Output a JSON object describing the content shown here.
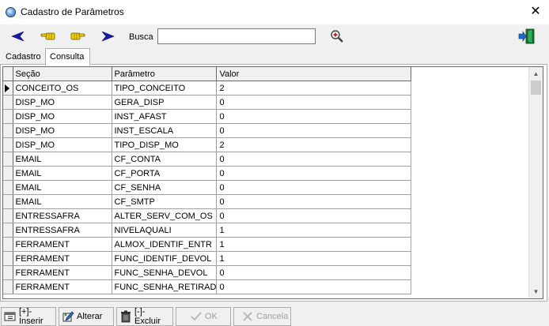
{
  "window": {
    "title": "Cadastro de Parâmetros",
    "close_glyph": "✕"
  },
  "toolbar": {
    "nav": [
      {
        "name": "first-record",
        "icon": "arrow-first-icon",
        "color": "#1a1aa8"
      },
      {
        "name": "prev-record",
        "icon": "hand-left-icon",
        "color": "#c8a000"
      },
      {
        "name": "next-record",
        "icon": "hand-right-icon",
        "color": "#c8a000"
      },
      {
        "name": "last-record",
        "icon": "arrow-last-icon",
        "color": "#1a1aa8"
      }
    ],
    "search_label": "Busca",
    "search_value": "",
    "search_icon": "zoom-icon",
    "exit_icon": "exit-door-icon"
  },
  "tabs": [
    {
      "label": "Cadastro",
      "active": false
    },
    {
      "label": "Consulta",
      "active": true
    }
  ],
  "grid": {
    "columns": [
      "Seção",
      "Parâmetro",
      "Valor"
    ],
    "rows": [
      [
        "CONCEITO_OS",
        "TIPO_CONCEITO",
        "2"
      ],
      [
        "DISP_MO",
        "GERA_DISP",
        "0"
      ],
      [
        "DISP_MO",
        "INST_AFAST",
        "0"
      ],
      [
        "DISP_MO",
        "INST_ESCALA",
        "0"
      ],
      [
        "DISP_MO",
        "TIPO_DISP_MO",
        "2"
      ],
      [
        "EMAIL",
        "CF_CONTA",
        "0"
      ],
      [
        "EMAIL",
        "CF_PORTA",
        "0"
      ],
      [
        "EMAIL",
        "CF_SENHA",
        "0"
      ],
      [
        "EMAIL",
        "CF_SMTP",
        "0"
      ],
      [
        "ENTRESSAFRA",
        "ALTER_SERV_COM_OS",
        "0"
      ],
      [
        "ENTRESSAFRA",
        "NIVELAQUALI",
        "1"
      ],
      [
        "FERRAMENT",
        "ALMOX_IDENTIF_ENTR",
        "1"
      ],
      [
        "FERRAMENT",
        "FUNC_IDENTIF_DEVOL",
        "1"
      ],
      [
        "FERRAMENT",
        "FUNC_SENHA_DEVOL",
        "0"
      ],
      [
        "FERRAMENT",
        "FUNC_SENHA_RETIRAD",
        "0"
      ]
    ],
    "selected_row": 0
  },
  "buttons": [
    {
      "name": "inserir-button",
      "label": "[+]-Inserir",
      "icon": "insert-icon",
      "enabled": true
    },
    {
      "name": "alterar-button",
      "label": "Alterar",
      "icon": "edit-icon",
      "enabled": true
    },
    {
      "name": "excluir-button",
      "label": "[-]-Excluir",
      "icon": "trash-icon",
      "enabled": true
    },
    {
      "name": "ok-button",
      "label": "OK",
      "icon": "check-icon",
      "enabled": false
    },
    {
      "name": "cancela-button",
      "label": "Cancela",
      "icon": "cancel-icon",
      "enabled": false
    }
  ]
}
